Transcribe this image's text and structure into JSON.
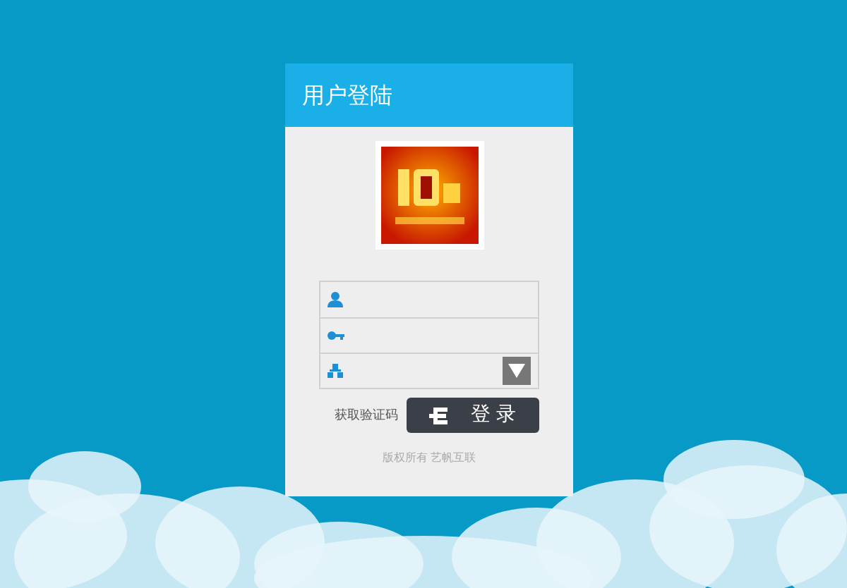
{
  "header": {
    "title": "用户登陆"
  },
  "fields": [
    {
      "kind": "user"
    },
    {
      "kind": "password"
    },
    {
      "kind": "select"
    }
  ],
  "captcha_link": "获取验证码",
  "login_button": "登 录",
  "footer": "版权所有 艺帆互联"
}
